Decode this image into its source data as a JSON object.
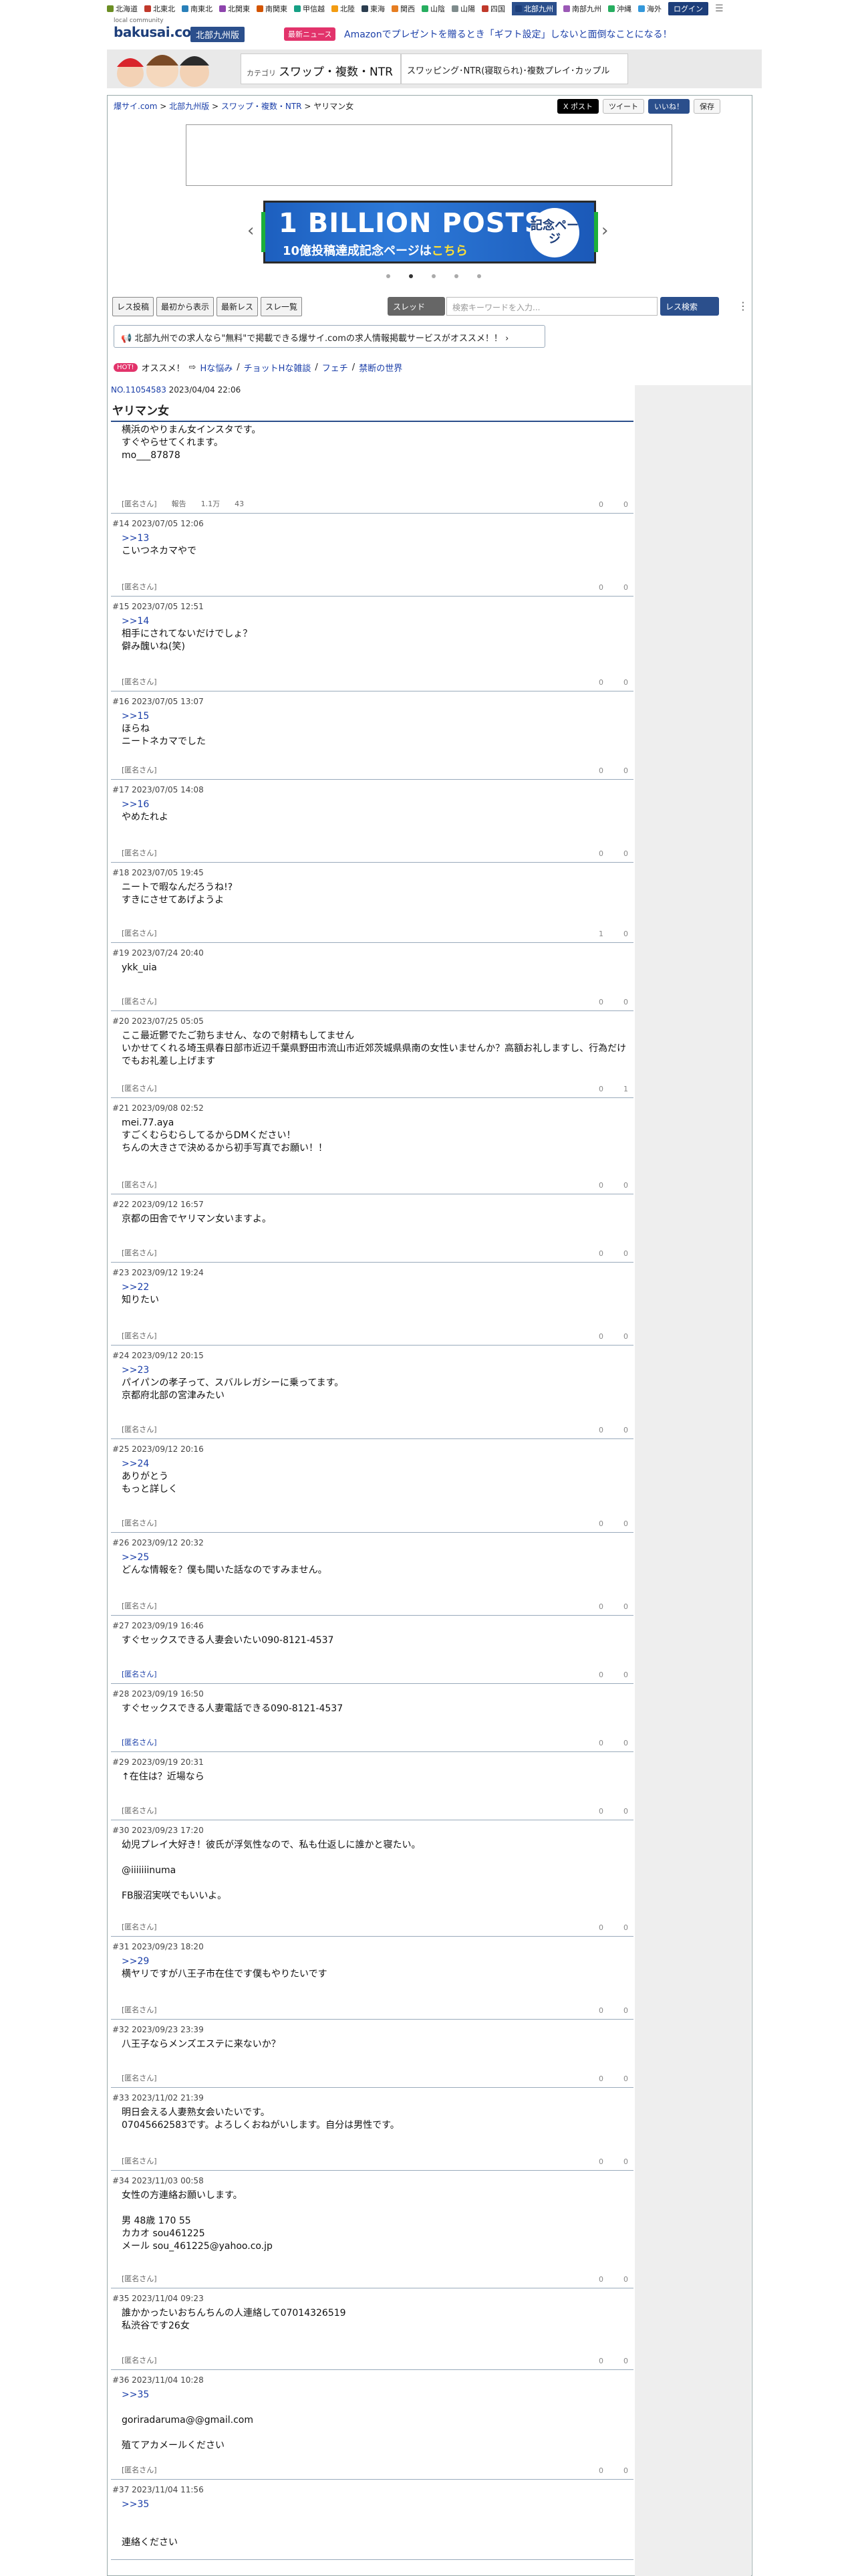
{
  "regions": [
    "北海道",
    "北東北",
    "南東北",
    "北関東",
    "南関東",
    "甲信越",
    "北陸",
    "東海",
    "関西",
    "山陰",
    "山陽",
    "四国",
    "北部九州",
    "南部九州",
    "沖縄",
    "海外"
  ],
  "active_region": "北部九州",
  "login": "ログイン",
  "logo": {
    "small": "local community",
    "big": "bakusai.com"
  },
  "area_badge": "北部九州版",
  "news_badge": "最新ニュース",
  "news_text": "Amazonでプレゼントを贈るとき「ギフト設定」しないと面倒なことになる！",
  "category": {
    "prefix": "カテゴリ",
    "title": "スワップ・複数・NTR",
    "sub": "スワッピング･NTR(寝取られ)･複数プレイ･カップル"
  },
  "breadcrumb": {
    "home": "爆サイ.com",
    "area": "北部九州版",
    "cat": "スワップ・複数・NTR",
    "thread": "ヤリマン女"
  },
  "share": {
    "x": "X ポスト",
    "tweet": "ツイート",
    "iine": "いいね！",
    "save": "保存"
  },
  "banner": {
    "line1": "1 BILLION POSTS",
    "line2a": "10億投稿達成記念ページは",
    "line2b": "こちら",
    "seal": "記念ページ"
  },
  "toolbar": {
    "b1": "レス投稿",
    "b2": "最初から表示",
    "b3": "最新レス",
    "b4": "スレ一覧",
    "sel": "スレッド",
    "placeholder": "検索キーワードを入力...",
    "search": "レス検索"
  },
  "promo": "北部九州での求人なら\"無料\"で掲載できる爆サイ.comの求人情報掲載サービスがオススメ！！",
  "hot": {
    "badge": "HOT!",
    "label": "オススメ！",
    "links": [
      "Hな悩み",
      "チョットHな雑談",
      "フェチ",
      "禁断の世界"
    ]
  },
  "thread": {
    "no": "NO.11054583",
    "date": "2023/04/04 22:06",
    "title": "ヤリマン女"
  },
  "posts": [
    {
      "hd": "",
      "body": "横浜のやりまん女インスタです。\nすぐやらせてくれます。\nmo___87878",
      "ft": "[匿名さん]　　報告　　1.1万　　43",
      "up": "0",
      "down": "0",
      "h": 142
    },
    {
      "hd": "#14  2023/07/05 12:06",
      "anchor": ">>13",
      "body": "こいつネカマやで",
      "ft": "[匿名さん]",
      "up": "0",
      "down": "0",
      "h": 124
    },
    {
      "hd": "#15  2023/07/05 12:51",
      "anchor": ">>14",
      "body": "相手にされてないだけでしょ？\n僻み醜いね(笑)",
      "ft": "[匿名さん]",
      "up": "0",
      "down": "0",
      "h": 142
    },
    {
      "hd": "#16  2023/07/05 13:07",
      "anchor": ">>15",
      "body": "ほらね\nニートネカマでした",
      "ft": "[匿名さん]",
      "up": "0",
      "down": "0",
      "h": 132
    },
    {
      "hd": "#17  2023/07/05 14:08",
      "anchor": ">>16",
      "body": "やめたれよ",
      "ft": "[匿名さん]",
      "up": "0",
      "down": "0",
      "h": 124
    },
    {
      "hd": "#18  2023/07/05 19:45",
      "anchor": "",
      "body": "ニートで暇なんだろうね!?\nすきにさせてあげようよ",
      "ft": "[匿名さん]",
      "up": "1",
      "down": "0",
      "h": 120
    },
    {
      "hd": "#19  2023/07/24 20:40",
      "anchor": "",
      "body": "ykk_uia",
      "ft": "[匿名さん]",
      "up": "0",
      "down": "0",
      "h": 102
    },
    {
      "hd": "#20  2023/07/25 05:05",
      "anchor": "",
      "body": "ここ最近鬱でたご勃ちません、なので射精もしてません\nいかせてくれる埼玉県春日部市近辺千葉県野田市流山市近郊茨城県県南の女性いませんか？高額お礼しますし、行為だけでもお礼差し上げます",
      "ft": "[匿名さん]",
      "up": "0",
      "down": "1",
      "h": 130
    },
    {
      "hd": "#21  2023/09/08 02:52",
      "anchor": "",
      "body": "mei.77.aya\nすごくむらむらしてるからDMください！\nちんの大きさで決めるから初手写真でお願い！！",
      "ft": "[匿名さん]",
      "up": "0",
      "down": "0",
      "h": 144
    },
    {
      "hd": "#22  2023/09/12 16:57",
      "anchor": "",
      "body": "京都の田舎でヤリマン女いますよ。",
      "ft": "[匿名さん]",
      "up": "0",
      "down": "0",
      "h": 102
    },
    {
      "hd": "#23  2023/09/12 19:24",
      "anchor": ">>22",
      "body": "知りたい",
      "ft": "[匿名さん]",
      "up": "0",
      "down": "0",
      "h": 124
    },
    {
      "hd": "#24  2023/09/12 20:15",
      "anchor": ">>23",
      "body": "パイパンの孝子って、スバルレガシーに乗ってます。\n京都府北部の宮津みたい",
      "ft": "[匿名さん]",
      "up": "0",
      "down": "0",
      "h": 140
    },
    {
      "hd": "#25  2023/09/12 20:16",
      "anchor": ">>24",
      "body": "ありがとう\nもっと詳しく",
      "ft": "[匿名さん]",
      "up": "0",
      "down": "0",
      "h": 140
    },
    {
      "hd": "#26  2023/09/12 20:32",
      "anchor": ">>25",
      "body": "どんな情報を？僕も聞いた話なのですみません。",
      "ft": "[匿名さん]",
      "up": "0",
      "down": "0",
      "h": 124
    },
    {
      "hd": "#27  2023/09/19 16:46",
      "anchor": "",
      "body": "すぐセックスできる人妻会いたい090-8121-4537",
      "ft": "[匿名さん]",
      "ftblue": true,
      "up": "0",
      "down": "0",
      "h": 102
    },
    {
      "hd": "#28  2023/09/19 16:50",
      "anchor": "",
      "body": "すぐセックスできる人妻電話できる090-8121-4537",
      "ft": "[匿名さん]",
      "ftblue": true,
      "up": "0",
      "down": "0",
      "h": 102
    },
    {
      "hd": "#29  2023/09/19 20:31",
      "anchor": "",
      "body": "↑在住は？近場なら",
      "ft": "[匿名さん]",
      "up": "0",
      "down": "0",
      "h": 102
    },
    {
      "hd": "#30  2023/09/23 17:20",
      "anchor": "",
      "body": "幼児プレイ大好き！彼氏が浮気性なので、私も仕返しに誰かと寝たい。\n\n@iiiiiiinuma\n\nFB服沼実咲でもいいよ。",
      "ft": "[匿名さん]",
      "up": "0",
      "down": "0",
      "h": 174
    },
    {
      "hd": "#31  2023/09/23 18:20",
      "anchor": ">>29",
      "body": "横ヤリですが八王子市在住です僕もやりたいです",
      "ft": "[匿名さん]",
      "up": "0",
      "down": "0",
      "h": 124
    },
    {
      "hd": "#32  2023/09/23 23:39",
      "anchor": "",
      "body": "八王子ならメンズエステに来ないか？",
      "ft": "[匿名さん]",
      "up": "0",
      "down": "0",
      "h": 102
    },
    {
      "hd": "#33  2023/11/02 21:39",
      "anchor": "",
      "body": "明日会える人妻熟女会いたいです。\n07045662583です。よろしくおねがいします。自分は男性です。",
      "ft": "[匿名さん]",
      "up": "0",
      "down": "0",
      "h": 124
    },
    {
      "hd": "#34  2023/11/03 00:58",
      "anchor": "",
      "body": "女性の方連絡お願いします。\n\n男 48歳 170 55\nカカオ sou461225\nメール sou_461225@yahoo.co.jp",
      "ft": "[匿名さん]",
      "up": "0",
      "down": "0",
      "h": 176
    },
    {
      "hd": "#35  2023/11/04 09:23",
      "anchor": "",
      "body": "誰かかったいおちんちんの人連絡して07014326519\n私渋谷です26女",
      "ft": "[匿名さん]",
      "up": "0",
      "down": "0",
      "h": 122
    },
    {
      "hd": "#36  2023/11/04 10:28",
      "anchor": ">>35",
      "body": "\ngoriradaruma@@gmail.com\n\n殖てアカメールください",
      "ft": "[匿名さん]",
      "up": "0",
      "down": "0",
      "h": 164
    },
    {
      "hd": "#37  2023/11/04 11:56",
      "anchor": ">>35",
      "body": "\n\n連絡ください",
      "ft": "",
      "up": "",
      "down": "",
      "h": 120
    }
  ]
}
